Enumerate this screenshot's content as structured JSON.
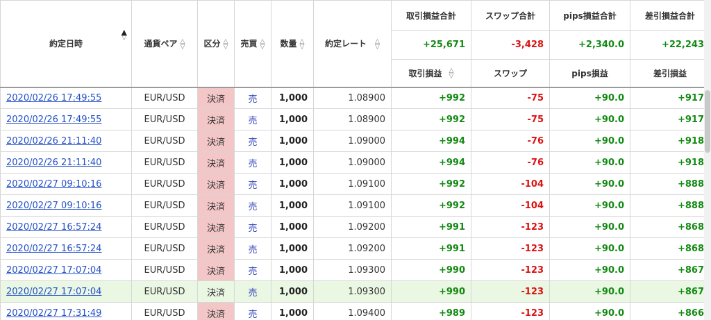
{
  "header": {
    "date": "約定日時",
    "pair": "通貨ペア",
    "kubun": "区分",
    "side": "売買",
    "qty": "数量",
    "rate": "約定レート",
    "totals_labels": [
      "取引損益合計",
      "スワップ合計",
      "pips損益合計",
      "差引損益合計"
    ],
    "totals_values": [
      "+25,671",
      "-3,428",
      "+2,340.0",
      "+22,243"
    ],
    "sub_labels": [
      "取引損益",
      "スワップ",
      "pips損益",
      "差引損益"
    ]
  },
  "rows": [
    {
      "date": "2020/02/26 17:49:55",
      "pair": "EUR/USD",
      "kubun": "決済",
      "side": "売",
      "qty": "1,000",
      "rate": "1.08900",
      "pl": "+992",
      "swap": "-75",
      "pips": "+90.0",
      "net": "+917"
    },
    {
      "date": "2020/02/26 17:49:55",
      "pair": "EUR/USD",
      "kubun": "決済",
      "side": "売",
      "qty": "1,000",
      "rate": "1.08900",
      "pl": "+992",
      "swap": "-75",
      "pips": "+90.0",
      "net": "+917"
    },
    {
      "date": "2020/02/26 21:11:40",
      "pair": "EUR/USD",
      "kubun": "決済",
      "side": "売",
      "qty": "1,000",
      "rate": "1.09000",
      "pl": "+994",
      "swap": "-76",
      "pips": "+90.0",
      "net": "+918"
    },
    {
      "date": "2020/02/26 21:11:40",
      "pair": "EUR/USD",
      "kubun": "決済",
      "side": "売",
      "qty": "1,000",
      "rate": "1.09000",
      "pl": "+994",
      "swap": "-76",
      "pips": "+90.0",
      "net": "+918"
    },
    {
      "date": "2020/02/27 09:10:16",
      "pair": "EUR/USD",
      "kubun": "決済",
      "side": "売",
      "qty": "1,000",
      "rate": "1.09100",
      "pl": "+992",
      "swap": "-104",
      "pips": "+90.0",
      "net": "+888"
    },
    {
      "date": "2020/02/27 09:10:16",
      "pair": "EUR/USD",
      "kubun": "決済",
      "side": "売",
      "qty": "1,000",
      "rate": "1.09100",
      "pl": "+992",
      "swap": "-104",
      "pips": "+90.0",
      "net": "+888"
    },
    {
      "date": "2020/02/27 16:57:24",
      "pair": "EUR/USD",
      "kubun": "決済",
      "side": "売",
      "qty": "1,000",
      "rate": "1.09200",
      "pl": "+991",
      "swap": "-123",
      "pips": "+90.0",
      "net": "+868"
    },
    {
      "date": "2020/02/27 16:57:24",
      "pair": "EUR/USD",
      "kubun": "決済",
      "side": "売",
      "qty": "1,000",
      "rate": "1.09200",
      "pl": "+991",
      "swap": "-123",
      "pips": "+90.0",
      "net": "+868"
    },
    {
      "date": "2020/02/27 17:07:04",
      "pair": "EUR/USD",
      "kubun": "決済",
      "side": "売",
      "qty": "1,000",
      "rate": "1.09300",
      "pl": "+990",
      "swap": "-123",
      "pips": "+90.0",
      "net": "+867"
    },
    {
      "date": "2020/02/27 17:07:04",
      "pair": "EUR/USD",
      "kubun": "決済",
      "side": "売",
      "qty": "1,000",
      "rate": "1.09300",
      "pl": "+990",
      "swap": "-123",
      "pips": "+90.0",
      "net": "+867"
    },
    {
      "date": "2020/02/27 17:31:49",
      "pair": "EUR/USD",
      "kubun": "決済",
      "side": "売",
      "qty": "1,000",
      "rate": "1.09400",
      "pl": "+989",
      "swap": "-123",
      "pips": "+90.0",
      "net": "+866"
    }
  ],
  "selected_row": 9,
  "colors": {
    "positive": "#138a13",
    "negative": "#dd1111",
    "kubun_bg": "#f3c7c7",
    "link": "#2250c8",
    "selected_bg": "#eaf7e3"
  }
}
